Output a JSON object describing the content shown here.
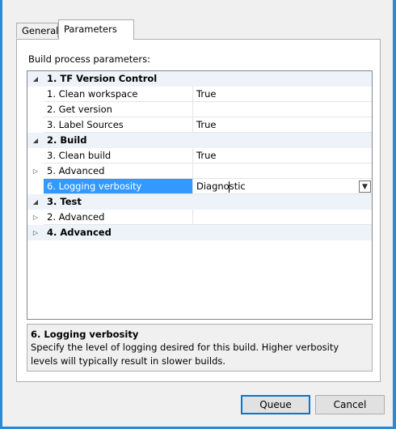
{
  "tabs": [
    {
      "label": "General"
    },
    {
      "label": "Parameters"
    }
  ],
  "panel": {
    "label": "Build process parameters:"
  },
  "rows": [
    {
      "kind": "category",
      "label": "1. TF Version Control",
      "expander": "◢"
    },
    {
      "kind": "prop",
      "name": "1. Clean workspace",
      "value": "True"
    },
    {
      "kind": "prop",
      "name": "2. Get version",
      "value": ""
    },
    {
      "kind": "prop",
      "name": "3. Label Sources",
      "value": "True"
    },
    {
      "kind": "category",
      "label": "2. Build",
      "expander": "◢"
    },
    {
      "kind": "prop",
      "name": "3. Clean build",
      "value": "True"
    },
    {
      "kind": "prop",
      "name": "5. Advanced",
      "value": "",
      "expander": "▷"
    },
    {
      "kind": "prop",
      "name": "6. Logging verbosity",
      "value": "Diagnostic",
      "selected": true
    },
    {
      "kind": "category",
      "label": "3. Test",
      "expander": "◢"
    },
    {
      "kind": "prop",
      "name": "2. Advanced",
      "value": "",
      "expander": "▷"
    },
    {
      "kind": "category",
      "label": "4. Advanced",
      "expander": "▷"
    }
  ],
  "description": {
    "title": "6. Logging verbosity",
    "text": "Specify the level of logging desired for this build. Higher verbosity levels will typically result in slower builds."
  },
  "buttons": {
    "queue": "Queue",
    "cancel": "Cancel"
  },
  "icons": {
    "expanded": "triangle-expanded-icon",
    "collapsed": "triangle-collapsed-icon",
    "dropdown": "chevron-down-icon"
  },
  "colors": {
    "selection": "#3399ff",
    "category_bg": "#eef3fa",
    "window_border": "#2a8ad4"
  }
}
